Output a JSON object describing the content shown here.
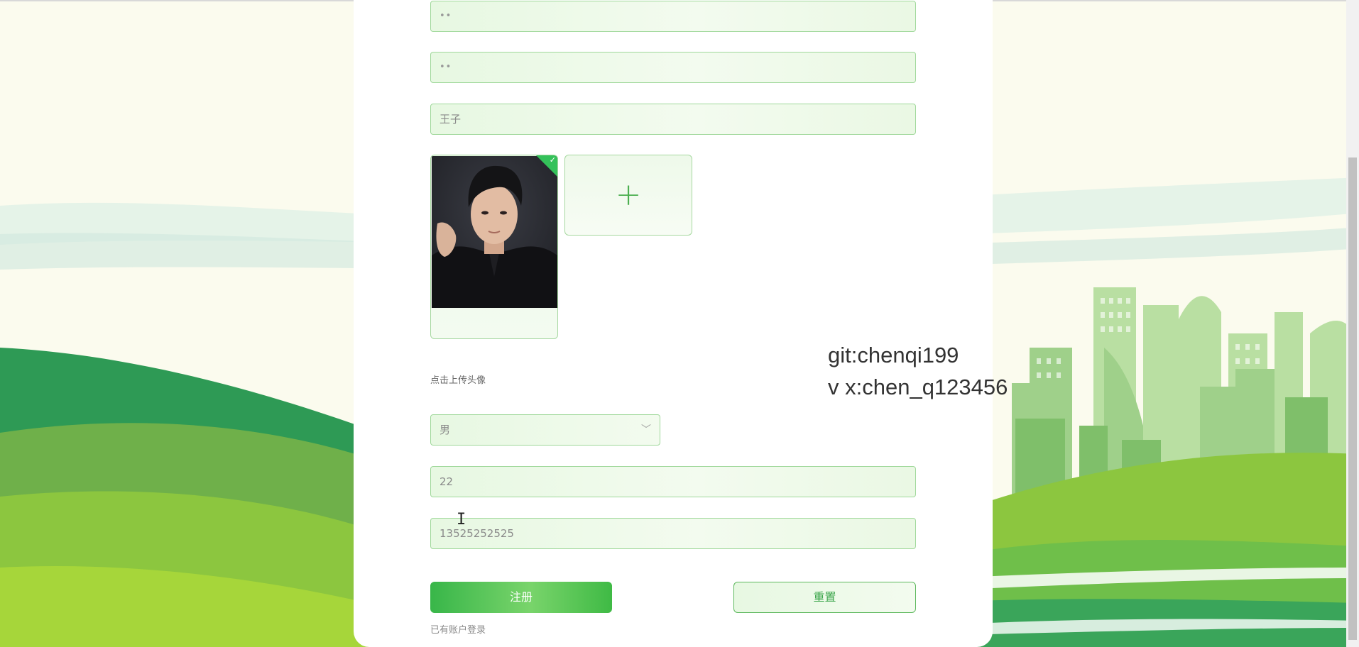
{
  "form": {
    "password_value": "••",
    "confirm_password_value": "••",
    "name_value": "王子",
    "upload_hint": "点击上传头像",
    "gender_value": "男",
    "age_value": "22",
    "phone_value": "13525252525",
    "register_label": "注册",
    "reset_label": "重置",
    "login_link": "已有账户登录"
  },
  "watermark": {
    "line1": "git:chenqi199",
    "line2": "v x:chen_q123456"
  },
  "colors": {
    "accent": "#3fba45",
    "field_border": "#9fd89a",
    "field_bg": "#eef9ea"
  },
  "icons": [
    "check-icon",
    "plus-icon",
    "chevron-down-icon",
    "text-cursor-icon"
  ]
}
